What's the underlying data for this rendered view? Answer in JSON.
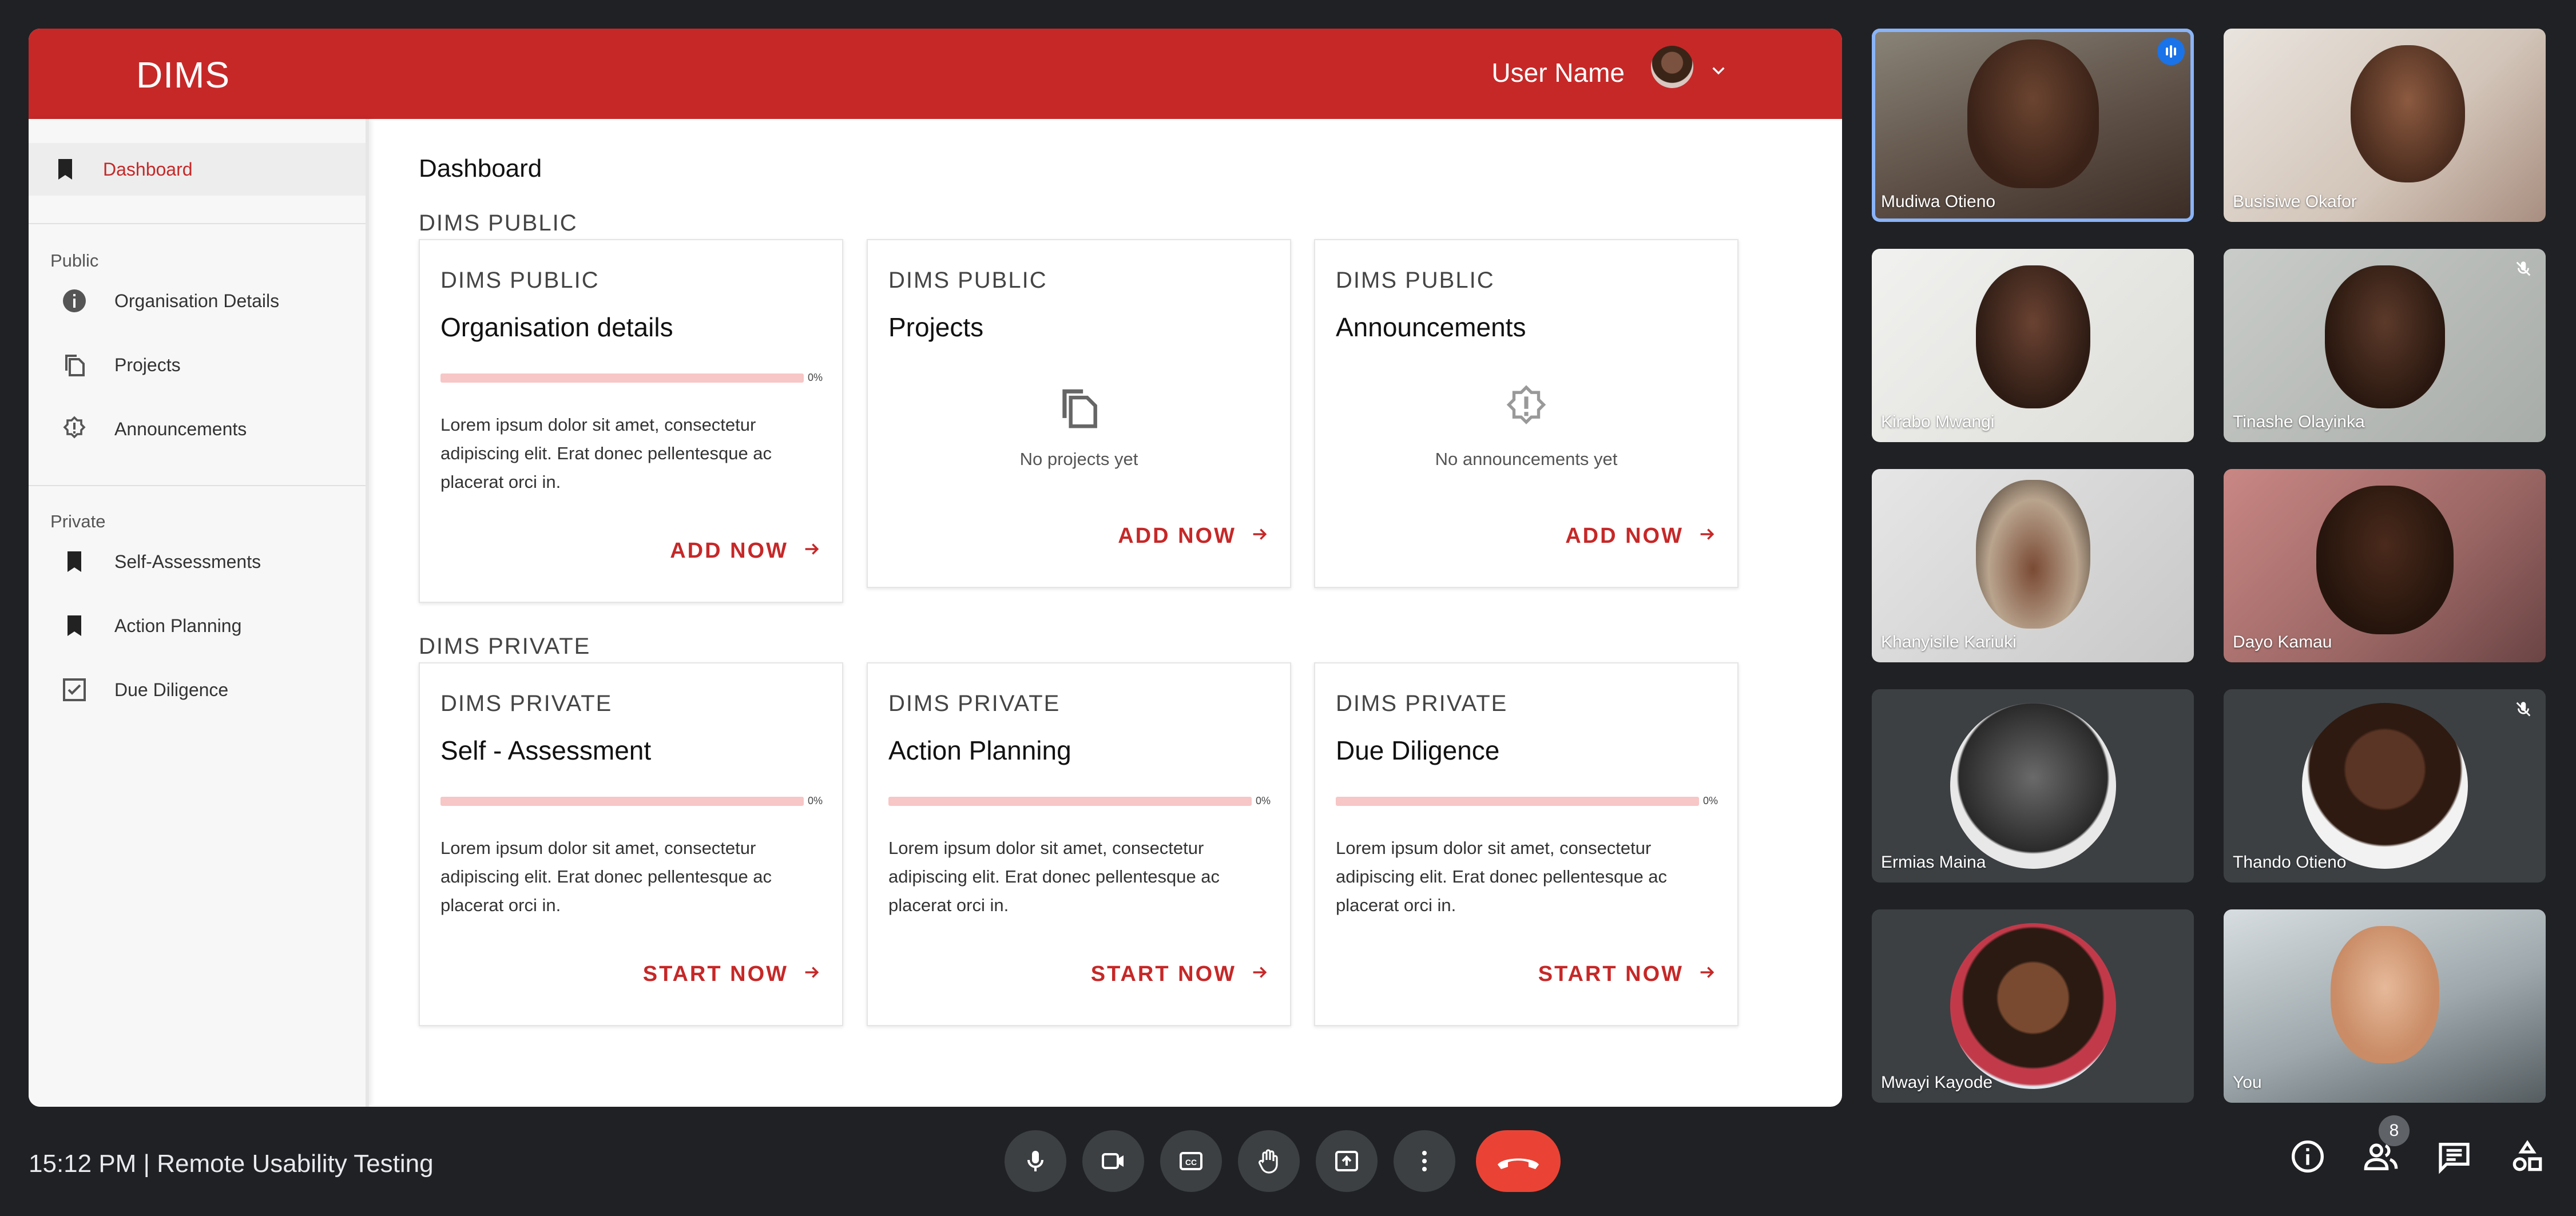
{
  "app": {
    "brand": "DIMS",
    "user_name": "User Name"
  },
  "sidebar": {
    "dashboard": "Dashboard",
    "public_label": "Public",
    "public_items": [
      "Organisation Details",
      "Projects",
      "Announcements"
    ],
    "private_label": "Private",
    "private_items": [
      "Self-Assessments",
      "Action Planning",
      "Due Diligence"
    ]
  },
  "main": {
    "page_title": "Dashboard",
    "public_section": "DIMS PUBLIC",
    "private_section": "DIMS PRIVATE",
    "public_cards": [
      {
        "tag": "DIMS PUBLIC",
        "title": "Organisation details",
        "progress": 0,
        "pct": "0%",
        "desc": "Lorem ipsum dolor sit amet, consectetur adipiscing elit. Erat donec pellentesque ac placerat orci in.",
        "action": "ADD NOW"
      },
      {
        "tag": "DIMS PUBLIC",
        "title": "Projects",
        "empty": "No projects yet",
        "action": "ADD NOW"
      },
      {
        "tag": "DIMS PUBLIC",
        "title": "Announcements",
        "empty": "No announcements yet",
        "action": "ADD NOW"
      }
    ],
    "private_cards": [
      {
        "tag": "DIMS PRIVATE",
        "title": "Self - Assessment",
        "progress": 0,
        "pct": "0%",
        "desc": "Lorem ipsum dolor sit amet, consectetur adipiscing elit. Erat donec pellentesque ac placerat orci in.",
        "action": "START NOW"
      },
      {
        "tag": "DIMS PRIVATE",
        "title": "Action Planning",
        "progress": 0,
        "pct": "0%",
        "desc": "Lorem ipsum dolor sit amet, consectetur adipiscing elit. Erat donec pellentesque ac placerat orci in.",
        "action": "START NOW"
      },
      {
        "tag": "DIMS PRIVATE",
        "title": "Due Diligence",
        "progress": 0,
        "pct": "0%",
        "desc": "Lorem ipsum dolor sit amet, consectetur adipiscing elit. Erat donec pellentesque ac placerat orci in.",
        "action": "START NOW"
      }
    ]
  },
  "participants": [
    {
      "name": "Mudiwa Otieno",
      "speaking": true
    },
    {
      "name": "Busisiwe Okafor"
    },
    {
      "name": "Kirabo Mwangi"
    },
    {
      "name": "Tinashe Olayinka",
      "muted": true
    },
    {
      "name": "Khanyisile Kariuki"
    },
    {
      "name": "Dayo Kamau"
    },
    {
      "name": "Ermias Maina"
    },
    {
      "name": "Thando Otieno",
      "muted": true
    },
    {
      "name": "Mwayi Kayode"
    },
    {
      "name": "You"
    }
  ],
  "meeting": {
    "info": "15:12 PM | Remote Usability Testing",
    "participant_count": "8"
  },
  "colors": {
    "brand": "#c62828",
    "meet_bg": "#202124",
    "hangup": "#ea4335"
  }
}
